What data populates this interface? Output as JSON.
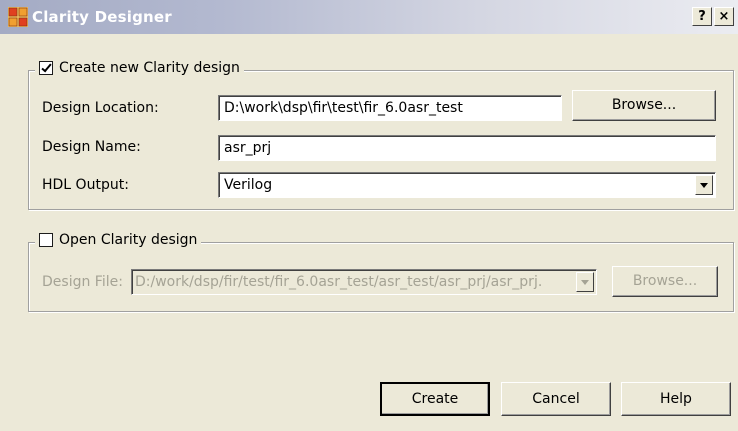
{
  "window": {
    "title": "Clarity Designer",
    "help_label": "?",
    "close_label": "×"
  },
  "create_group": {
    "checkbox_label": "Create new Clarity design",
    "checked": true,
    "location_label": "Design Location:",
    "location_value": "D:\\work\\dsp\\fir\\test\\fir_6.0asr_test",
    "browse_label": "Browse...",
    "name_label": "Design Name:",
    "name_value": "asr_prj",
    "hdl_label": "HDL Output:",
    "hdl_value": "Verilog"
  },
  "open_group": {
    "checkbox_label": "Open Clarity design",
    "checked": false,
    "file_label": "Design File:",
    "file_value": "D:/work/dsp/fir/test/fir_6.0asr_test/asr_test/asr_prj/asr_prj.",
    "browse_label": "Browse..."
  },
  "footer": {
    "create_label": "Create",
    "cancel_label": "Cancel",
    "help_label": "Help"
  }
}
